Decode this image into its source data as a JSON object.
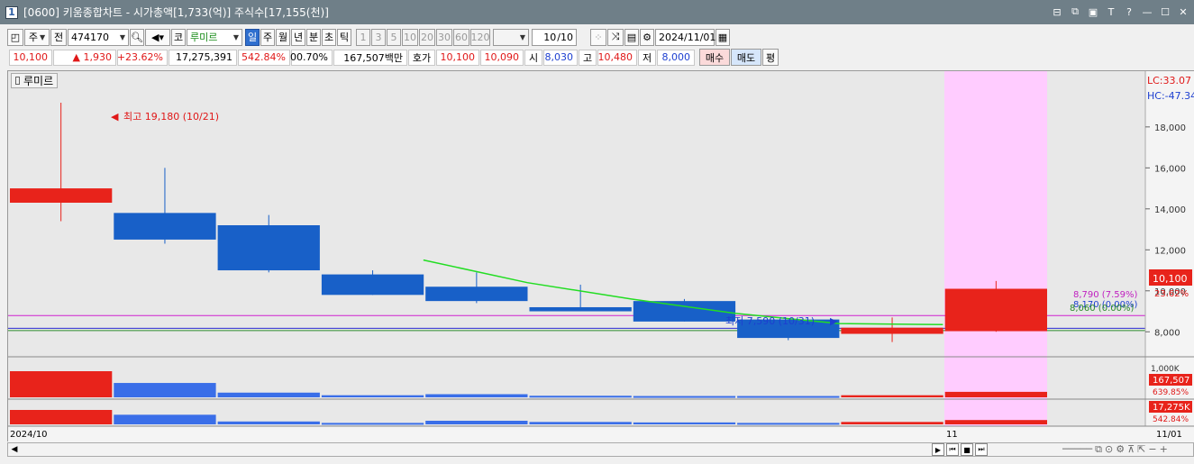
{
  "window": {
    "number": "1",
    "title": "[0600] 키움종합차트 - 시가총액[1,733(억)] 주식수[17,155(천)]"
  },
  "toolbar1": {
    "period_select": "주",
    "prev_label": "전",
    "code": "474170",
    "code_type": "코",
    "stock_name": "루미르",
    "periods": [
      "일",
      "주",
      "월",
      "년",
      "분",
      "초",
      "틱"
    ],
    "selected_period": "일",
    "minutes": [
      "1",
      "3",
      "5",
      "10",
      "20",
      "30",
      "60",
      "120"
    ],
    "count": "10",
    "count_total": "/10",
    "date": "2024/11/01"
  },
  "toolbar2": {
    "price": "10,100",
    "change": "▲ 1,930",
    "change_pct": "+23.62%",
    "volume": "17,275,391",
    "volume_pct": "542.84%",
    "turnover": "00.70%",
    "amount": "167,507백만",
    "quote_label": "호가",
    "ask": "10,100",
    "bid": "10,090",
    "open_label": "시",
    "open": "8,030",
    "high_label": "고",
    "high": "10,480",
    "low_label": "저",
    "low": "8,000",
    "buy_label": "매수",
    "sell_label": "매도",
    "eval_label": "평"
  },
  "chart": {
    "stock_label": "루미르",
    "high_annotation": "최고 19,180 (10/21)",
    "low_annotation": "최저 7,590 (10/31)",
    "lc_label": "LC:33.07",
    "hc_label": "HC:-47.34",
    "last_price_label": "10,100",
    "last_pct_label": "23.62%",
    "ref_line_label": "8,790 (7.59%)",
    "ref_line_label2": "8,170 (0.00%)",
    "ref_line_label3": "8,060 (0.00%)",
    "vol_axis_label": "1,000K",
    "vol_value": "167,507",
    "vol_pct": "639.85%",
    "vol2_value": "17,275K",
    "vol2_pct": "542.84%",
    "x_label_left": "2024/10",
    "x_label_mid": "11",
    "x_label_right": "11/01",
    "colors": {
      "up": "#e8231b",
      "down": "#1860c8",
      "ma": "#22dd22",
      "highlight": "#ffccff"
    }
  },
  "chart_data": {
    "type": "candlestick",
    "y_ticks": [
      8000,
      10000,
      12000,
      14000,
      16000,
      18000
    ],
    "ylim": [
      7000,
      20500
    ],
    "candles": [
      {
        "open": 14300,
        "close": 15000,
        "high": 19180,
        "low": 13400
      },
      {
        "open": 13800,
        "close": 12500,
        "high": 16000,
        "low": 12300
      },
      {
        "open": 13200,
        "close": 11000,
        "high": 13700,
        "low": 10900
      },
      {
        "open": 10800,
        "close": 9800,
        "high": 11000,
        "low": 9800
      },
      {
        "open": 10200,
        "close": 9500,
        "high": 10900,
        "low": 9400
      },
      {
        "open": 9200,
        "close": 9000,
        "high": 10300,
        "low": 9000
      },
      {
        "open": 9500,
        "close": 8500,
        "high": 9600,
        "low": 8500
      },
      {
        "open": 8600,
        "close": 7700,
        "high": 8600,
        "low": 7590
      },
      {
        "open": 7900,
        "close": 8200,
        "high": 8700,
        "low": 7500
      },
      {
        "open": 8030,
        "close": 10100,
        "high": 10480,
        "low": 8000
      }
    ],
    "ma_line": [
      null,
      null,
      null,
      null,
      11500,
      10400,
      9600,
      8900,
      8400,
      8350
    ],
    "volume": [
      100,
      55,
      18,
      8,
      12,
      6,
      5,
      5,
      8,
      21
    ],
    "volume2": [
      60,
      40,
      12,
      6,
      15,
      10,
      8,
      6,
      10,
      18
    ],
    "ref_lines": [
      8790,
      8170,
      8060
    ]
  }
}
